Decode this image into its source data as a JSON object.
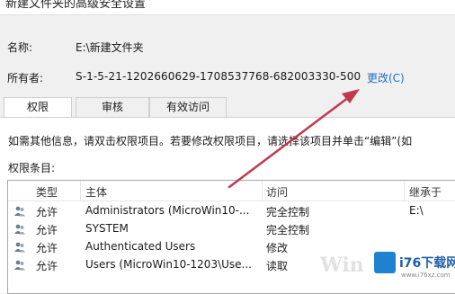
{
  "window": {
    "title": "新建文件夹的高级安全设置"
  },
  "fields": {
    "name_label": "名称:",
    "name_value": "E:\\新建文件夹",
    "owner_label": "所有者:",
    "owner_value": "S-1-5-21-1202660629-1708537768-682003330-500",
    "change_link": "更改(C)"
  },
  "tabs": [
    {
      "label": "权限",
      "active": true
    },
    {
      "label": "审核",
      "active": false
    },
    {
      "label": "有效访问",
      "active": false
    }
  ],
  "info_text": "如需其他信息，请双击权限项目。若要修改权限项目，请选择该项目并单击“编辑”(如",
  "entries_label": "权限条目:",
  "table": {
    "columns": [
      "类型",
      "主体",
      "访问",
      "继承于"
    ],
    "rows": [
      {
        "icon": "users-icon",
        "type": "允许",
        "principal": "Administrators (MicroWin10-...",
        "access": "完全控制",
        "inherited": "E:\\"
      },
      {
        "icon": "users-icon",
        "type": "允许",
        "principal": "SYSTEM",
        "access": "完全控制",
        "inherited": ""
      },
      {
        "icon": "users-icon",
        "type": "允许",
        "principal": "Authenticated Users",
        "access": "修改",
        "inherited": ""
      },
      {
        "icon": "users-icon",
        "type": "允许",
        "principal": "Users (MicroWin10-1203\\Use...",
        "access": "读取",
        "inherited": ""
      }
    ]
  },
  "watermark": {
    "brand": "i76下载网",
    "domain": "www.i76xz.com",
    "ghost_text": "Win"
  },
  "colors": {
    "link": "#1d6fbf",
    "arrow": "#c0394d",
    "brand": "#1f82cf"
  }
}
